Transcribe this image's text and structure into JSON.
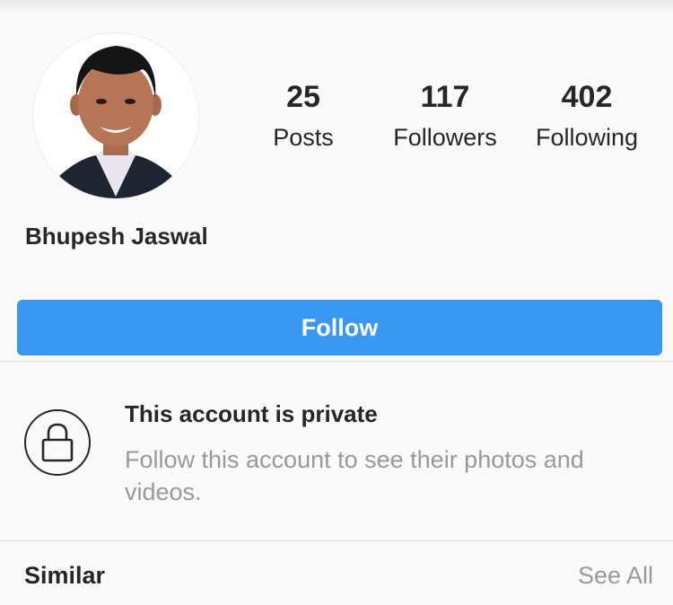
{
  "profile": {
    "name": "Bhupesh Jaswal",
    "avatar_icon": "profile-photo"
  },
  "stats": {
    "posts": {
      "count": "25",
      "label": "Posts"
    },
    "followers": {
      "count": "117",
      "label": "Followers"
    },
    "following": {
      "count": "402",
      "label": "Following"
    }
  },
  "actions": {
    "follow_label": "Follow"
  },
  "private_notice": {
    "icon": "lock-icon",
    "title": "This account is private",
    "description": "Follow this account to see their photos and videos."
  },
  "similar": {
    "label": "Similar",
    "see_all_label": "See All"
  },
  "colors": {
    "accent": "#3897f0",
    "background": "#fafafa",
    "text": "#262626",
    "secondary_text": "#999999"
  }
}
